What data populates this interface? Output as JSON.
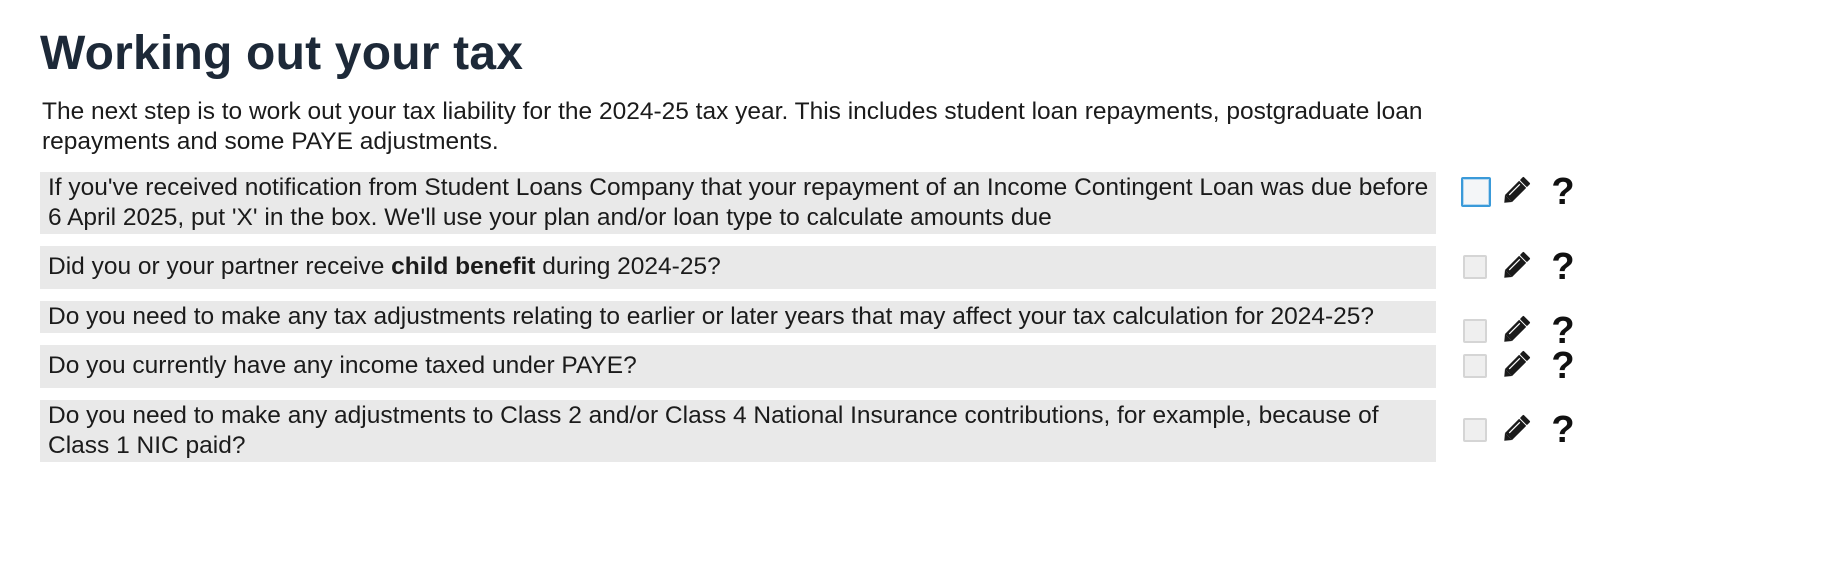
{
  "page": {
    "title": "Working out your tax",
    "intro": "The next step is to work out your tax liability for the 2024-25 tax year. This includes student loan repayments, postgraduate loan repayments and some PAYE adjustments."
  },
  "questions": [
    {
      "text": "If you've received notification from Student Loans Company that your repayment of an Income Contingent Loan was due before 6 April 2025, put 'X' in the box. We'll use your plan and/or loan type to calculate amounts due",
      "checked": false,
      "focused": true
    },
    {
      "text_before": "Did you or your partner receive ",
      "text_bold": "child benefit",
      "text_after": " during 2024-25?",
      "checked": false,
      "focused": false
    },
    {
      "text": "Do you need to make any tax adjustments relating to earlier or later years that may affect your tax calculation for 2024-25?",
      "checked": false,
      "focused": false
    },
    {
      "text": "Do you currently have any income taxed under PAYE?",
      "checked": false,
      "focused": false
    },
    {
      "text": "Do you need to make any adjustments to Class 2 and/or Class 4 National Insurance contributions, for example, because of Class 1 NIC paid?",
      "checked": false,
      "focused": false
    }
  ],
  "controls": {
    "edit_icon": "pencil-icon",
    "help_icon": "question-mark-icon",
    "help_label": "?"
  },
  "colors": {
    "title": "#1d2938",
    "row_background": "#e9e9e9",
    "focus_border": "#3a9ad9"
  }
}
